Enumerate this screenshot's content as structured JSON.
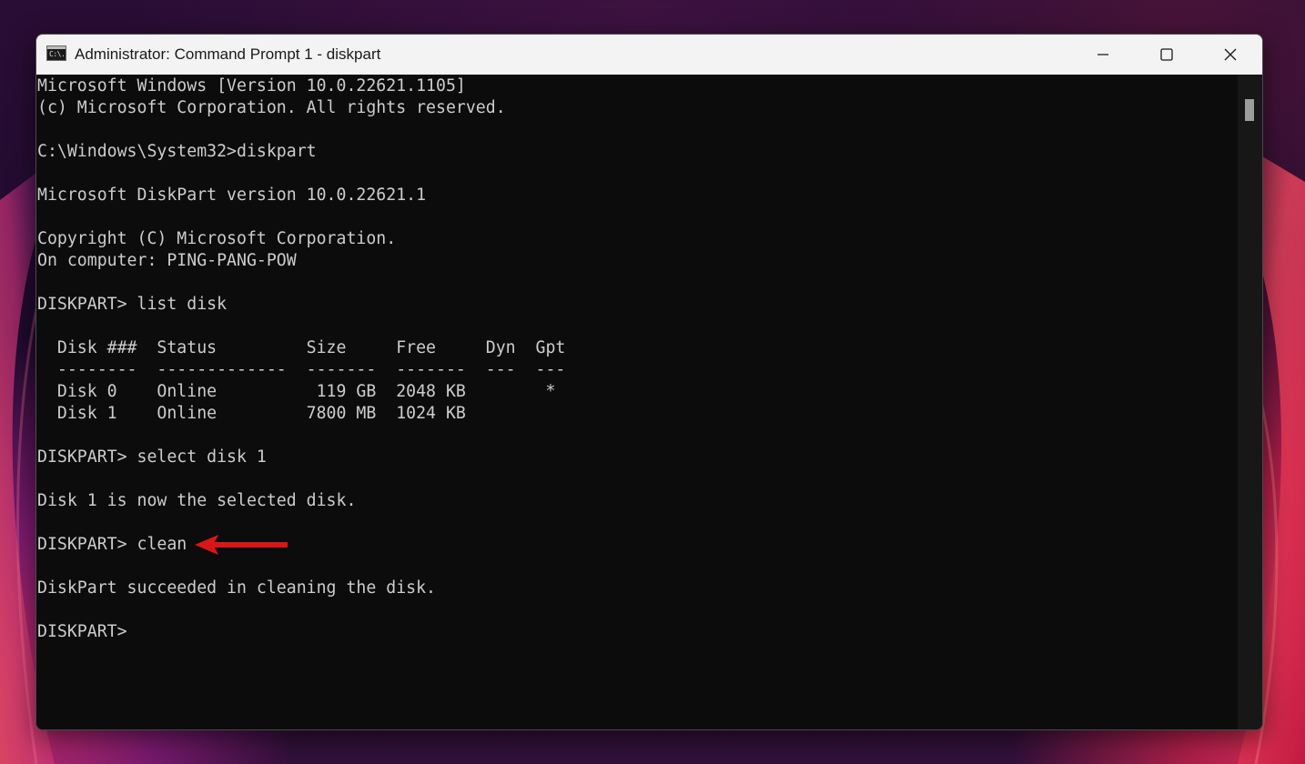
{
  "window": {
    "title": "Administrator: Command Prompt 1 - diskpart",
    "app_icon": "cmd-icon",
    "app_icon_text": "C:\\."
  },
  "controls": {
    "minimize_icon": "minimize-icon",
    "maximize_icon": "maximize-icon",
    "close_icon": "close-icon"
  },
  "console": {
    "lines": [
      "Microsoft Windows [Version 10.0.22621.1105]",
      "(c) Microsoft Corporation. All rights reserved.",
      "",
      "C:\\Windows\\System32>diskpart",
      "",
      "Microsoft DiskPart version 10.0.22621.1",
      "",
      "Copyright (C) Microsoft Corporation.",
      "On computer: PING-PANG-POW",
      "",
      "DISKPART> list disk",
      "",
      "  Disk ###  Status         Size     Free     Dyn  Gpt",
      "  --------  -------------  -------  -------  ---  ---",
      "  Disk 0    Online          119 GB  2048 KB        *",
      "  Disk 1    Online         7800 MB  1024 KB",
      "",
      "DISKPART> select disk 1",
      "",
      "Disk 1 is now the selected disk.",
      "",
      "DISKPART> clean",
      "",
      "DiskPart succeeded in cleaning the disk.",
      "",
      "DISKPART>"
    ]
  },
  "annotation": {
    "arrow_icon": "red-arrow-icon",
    "color": "#e01818"
  },
  "colors": {
    "console_bg": "#0c0c0c",
    "console_text": "#cccccc",
    "titlebar_bg": "#f3f3f3"
  }
}
